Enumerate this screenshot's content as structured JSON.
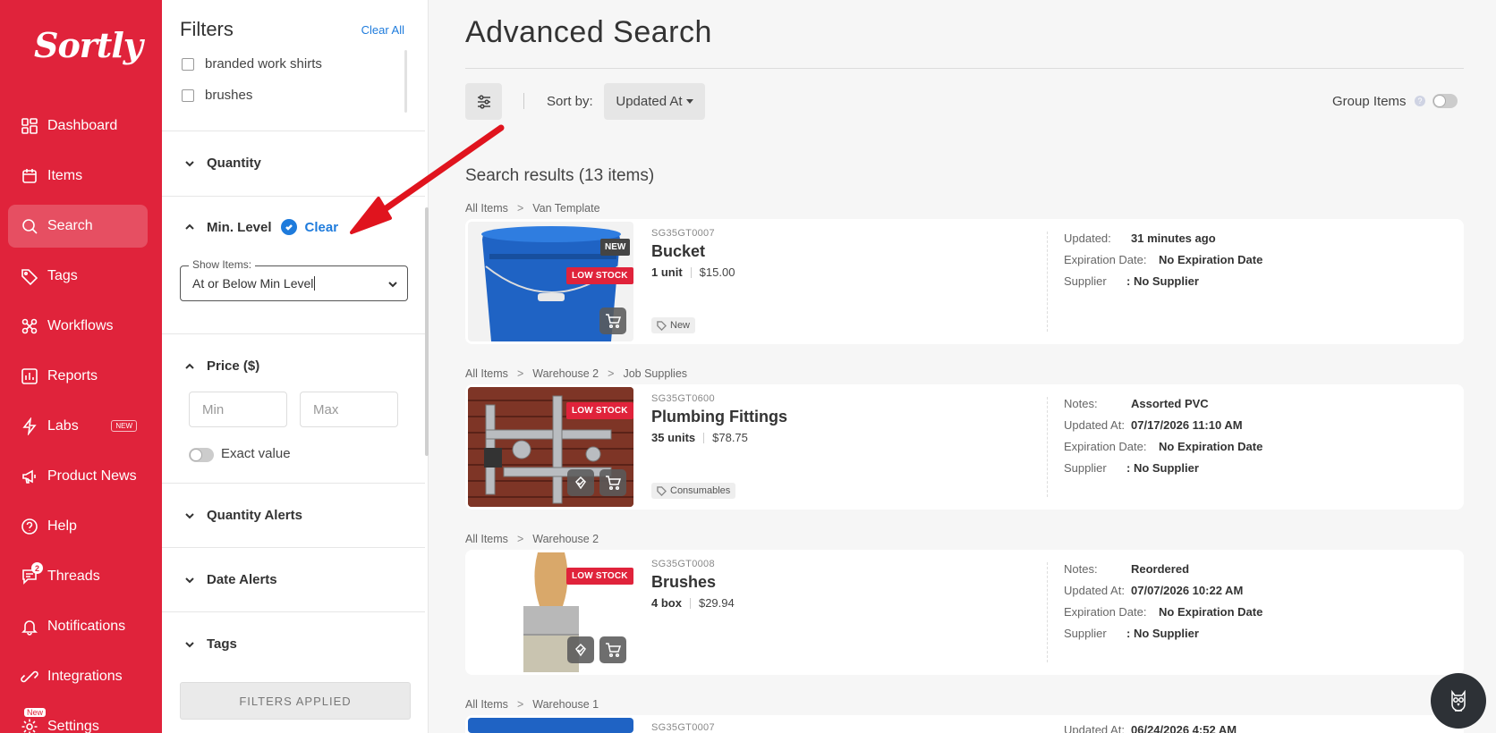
{
  "app": {
    "logo": "Sortly"
  },
  "nav": {
    "items": [
      {
        "label": "Dashboard",
        "icon": "dashboard-icon"
      },
      {
        "label": "Items",
        "icon": "items-icon"
      },
      {
        "label": "Search",
        "icon": "search-icon",
        "active": true
      },
      {
        "label": "Tags",
        "icon": "tag-icon"
      },
      {
        "label": "Workflows",
        "icon": "workflows-icon"
      },
      {
        "label": "Reports",
        "icon": "reports-icon"
      },
      {
        "label": "Labs",
        "icon": "labs-icon",
        "badge": "NEW"
      },
      {
        "label": "Product News",
        "icon": "megaphone-icon"
      },
      {
        "label": "Help",
        "icon": "help-icon"
      },
      {
        "label": "Threads",
        "icon": "threads-icon",
        "count": "2"
      },
      {
        "label": "Notifications",
        "icon": "bell-icon"
      },
      {
        "label": "Integrations",
        "icon": "integrations-icon"
      },
      {
        "label": "Settings",
        "icon": "gear-icon",
        "new_badge": "New"
      }
    ]
  },
  "filters": {
    "title": "Filters",
    "clear_all": "Clear All",
    "tag_options": [
      "branded work shirts",
      "brushes"
    ],
    "quantity": "Quantity",
    "min_level": {
      "label": "Min. Level",
      "clear": "Clear",
      "show_items_label": "Show Items:",
      "show_items_value": "At or Below Min Level"
    },
    "price": {
      "label": "Price ($)",
      "min_placeholder": "Min",
      "max_placeholder": "Max",
      "exact_value": "Exact value"
    },
    "quantity_alerts": "Quantity Alerts",
    "date_alerts": "Date Alerts",
    "tags": "Tags",
    "applied_button": "FILTERS APPLIED"
  },
  "main": {
    "title": "Advanced Search",
    "sort_by_label": "Sort by:",
    "sort_value": "Updated At",
    "group_items": "Group Items",
    "help_glyph": "?",
    "results_title": "Search results (13 items)"
  },
  "results": [
    {
      "breadcrumb": [
        "All Items",
        "Van Template"
      ],
      "sku": "SG35GT0007",
      "name": "Bucket",
      "qty": "1 unit",
      "price": "$15.00",
      "badge": "LOW STOCK",
      "new_tag": "NEW",
      "tag": "New",
      "meta": [
        {
          "k": "Updated:",
          "v": "31 minutes ago"
        },
        {
          "k": "Expiration Date:",
          "v": "No Expiration Date"
        },
        {
          "k": "Supplier",
          "v": ": No Supplier"
        }
      ]
    },
    {
      "breadcrumb": [
        "All Items",
        "Warehouse 2",
        "Job Supplies"
      ],
      "sku": "SG35GT0600",
      "name": "Plumbing Fittings",
      "qty": "35 units",
      "price": "$78.75",
      "badge": "LOW STOCK",
      "tag": "Consumables",
      "meta": [
        {
          "k": "Notes:",
          "v": "Assorted PVC"
        },
        {
          "k": "Updated At:",
          "v": "07/17/2026 11:10 AM"
        },
        {
          "k": "Expiration Date:",
          "v": "No Expiration Date"
        },
        {
          "k": "Supplier",
          "v": ": No Supplier"
        }
      ]
    },
    {
      "breadcrumb": [
        "All Items",
        "Warehouse 2"
      ],
      "sku": "SG35GT0008",
      "name": "Brushes",
      "qty": "4 box",
      "price": "$29.94",
      "badge": "LOW STOCK",
      "meta": [
        {
          "k": "Notes:",
          "v": "Reordered"
        },
        {
          "k": "Updated At:",
          "v": "07/07/2026 10:22 AM"
        },
        {
          "k": "Expiration Date:",
          "v": "No Expiration Date"
        },
        {
          "k": "Supplier",
          "v": ": No Supplier"
        }
      ]
    },
    {
      "breadcrumb": [
        "All Items",
        "Warehouse 1"
      ],
      "sku": "SG35GT0007",
      "meta": [
        {
          "k": "Updated At:",
          "v": "06/24/2026 4:52 AM"
        }
      ]
    }
  ],
  "colors": {
    "brand": "#e0233b",
    "accent": "#1e7bdc",
    "annotation_arrow": "#e0141e"
  }
}
